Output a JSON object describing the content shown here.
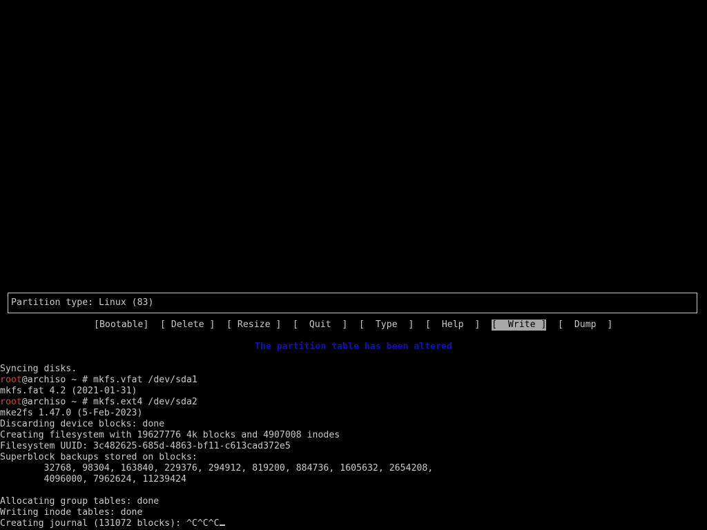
{
  "partition_info": {
    "label": "Partition type: Linux (83)"
  },
  "menu": {
    "items": [
      {
        "label": "[Bootable]",
        "selected": false
      },
      {
        "label": "[ Delete ]",
        "selected": false
      },
      {
        "label": "[ Resize ]",
        "selected": false
      },
      {
        "label": "[  Quit  ]",
        "selected": false
      },
      {
        "label": "[  Type  ]",
        "selected": false
      },
      {
        "label": "[  Help  ]",
        "selected": false
      },
      {
        "label": "[  Write ]",
        "selected": true
      },
      {
        "label": "[  Dump  ]",
        "selected": false
      }
    ]
  },
  "status_message": "The partition table has been altered",
  "terminal": {
    "lines": [
      {
        "text": "Syncing disks."
      },
      {
        "user": "root",
        "prompt_rest": "@archiso ~ # ",
        "command": "mkfs.vfat /dev/sda1"
      },
      {
        "text": "mkfs.fat 4.2 (2021-01-31)"
      },
      {
        "user": "root",
        "prompt_rest": "@archiso ~ # ",
        "command": "mkfs.ext4 /dev/sda2"
      },
      {
        "text": "mke2fs 1.47.0 (5-Feb-2023)"
      },
      {
        "text": "Discarding device blocks: done"
      },
      {
        "text": "Creating filesystem with 19627776 4k blocks and 4907008 inodes"
      },
      {
        "text": "Filesystem UUID: 3c482625-685d-4863-bf11-c613cad372e5"
      },
      {
        "text": "Superblock backups stored on blocks:"
      },
      {
        "text": "        32768, 98304, 163840, 229376, 294912, 819200, 884736, 1605632, 2654208,"
      },
      {
        "text": "        4096000, 7962624, 11239424"
      },
      {
        "text": ""
      },
      {
        "text": "Allocating group tables: done"
      },
      {
        "text": "Writing inode tables: done"
      },
      {
        "text": "Creating journal (131072 blocks): ^C^C^C"
      }
    ]
  },
  "colors": {
    "background": "#000000",
    "foreground": "#c8c8c8",
    "prompt_user": "#e23c3c",
    "status_message": "#1010c0",
    "selected_bg": "#a8a8a8"
  }
}
